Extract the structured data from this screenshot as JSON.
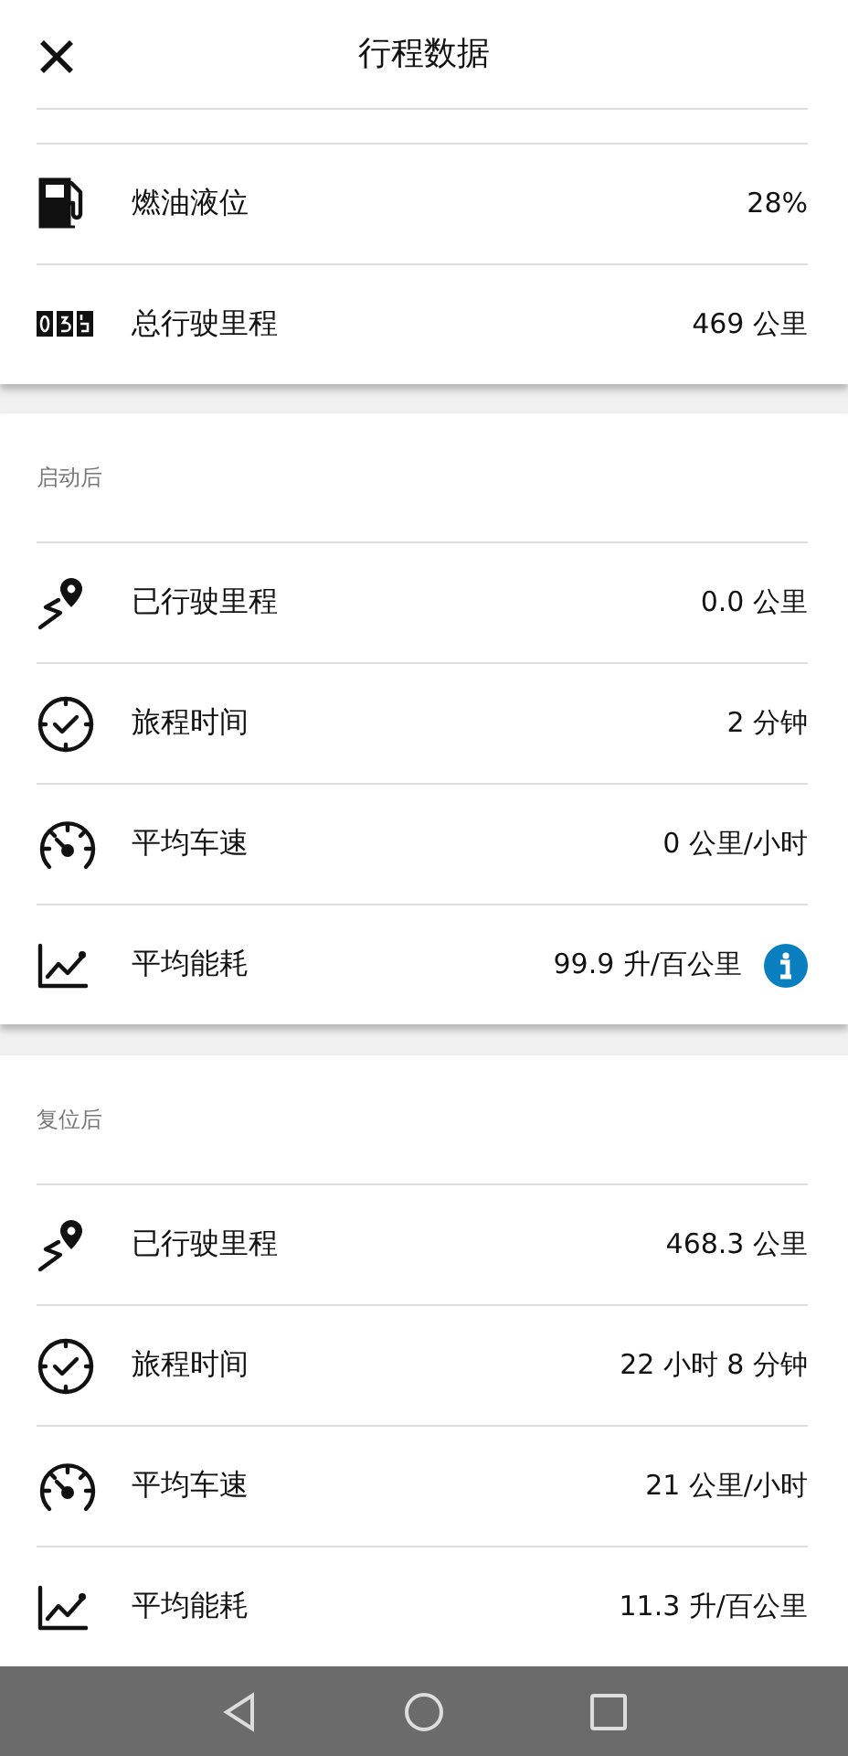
{
  "header": {
    "title": "行程数据"
  },
  "summary": [
    {
      "kind": "fuel",
      "label": "燃油液位",
      "value": "28%"
    },
    {
      "kind": "odometer",
      "label": "总行驶里程",
      "value": "469 公里"
    }
  ],
  "sections": [
    {
      "title": "启动后",
      "rows": [
        {
          "kind": "distance",
          "label": "已行驶里程",
          "value": "0.0 公里",
          "info": false
        },
        {
          "kind": "clock",
          "label": "旅程时间",
          "value": "2 分钟",
          "info": false
        },
        {
          "kind": "speed",
          "label": "平均车速",
          "value": "0 公里/小时",
          "info": false
        },
        {
          "kind": "chart",
          "label": "平均能耗",
          "value": "99.9 升/百公里",
          "info": true
        }
      ]
    },
    {
      "title": "复位后",
      "rows": [
        {
          "kind": "distance",
          "label": "已行驶里程",
          "value": "468.3 公里",
          "info": false
        },
        {
          "kind": "clock",
          "label": "旅程时间",
          "value": "22 小时 8 分钟",
          "info": false
        },
        {
          "kind": "speed",
          "label": "平均车速",
          "value": "21 公里/小时",
          "info": false
        },
        {
          "kind": "chart",
          "label": "平均能耗",
          "value": "11.3 升/百公里",
          "info": false
        }
      ]
    }
  ]
}
